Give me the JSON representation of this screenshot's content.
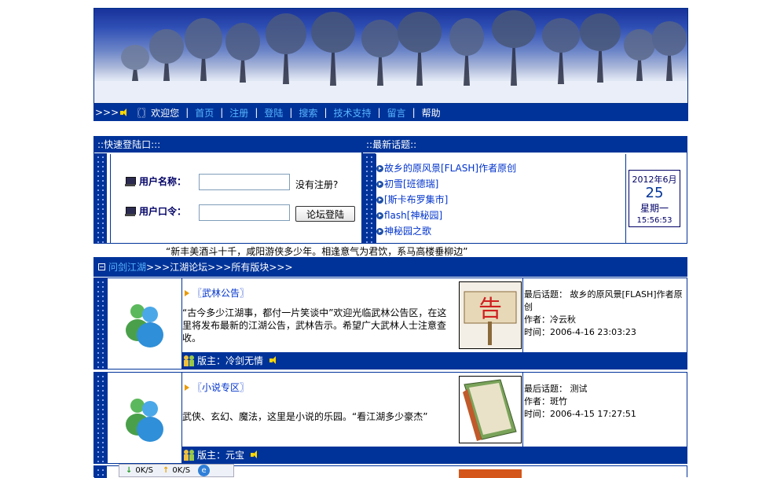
{
  "nav": {
    "arrows": ">>>",
    "welcome": "〖〗欢迎您",
    "links": [
      "首页",
      "注册",
      "登陆",
      "搜索",
      "技术支持",
      "留言"
    ],
    "help": "帮助"
  },
  "login": {
    "header": "::快速登陆口:::",
    "username_label": "用户名称：",
    "password_label": "用户口令：",
    "register_hint": "没有注册?",
    "submit_label": "论坛登陆"
  },
  "latest": {
    "header": "::最新话题::",
    "topics": [
      "故乡的原风景[FLASH]作者原创",
      "初雪[班德瑞]",
      "[斯卡布罗集市]",
      "flash[神秘园]",
      "神秘园之歌"
    ],
    "calendar": {
      "year_month": "2012年6月",
      "day": "25",
      "weekday": "星期一",
      "time": "15:56:53"
    }
  },
  "quote": "“新丰美酒斗十千，咸阳游侠多少年。相逢意气为君饮，系马高楼垂柳边”",
  "breadcrumb": {
    "link": "问剑江湖",
    "rest": ">>>江湖论坛>>>所有版块>>>"
  },
  "forums": [
    {
      "title": "〖武林公告〗",
      "description": "“古今多少江湖事，都付一片笑谈中”欢迎光临武林公告区，在这里将发布最新的江湖公告，武林告示。希望广大武林人士注意查收。",
      "last_topic_label": "最后话题：",
      "last_topic": "故乡的原风景[FLASH]作者原创",
      "author_label": "作者：",
      "author": "冷云秋",
      "time_label": "时间：",
      "time": "2006-4-16 23:03:23",
      "moderator_label": "版主：",
      "moderator": "冷剑无情",
      "thumb_glyph": "告"
    },
    {
      "title": "〖小说专区〗",
      "description": "武侠、玄幻、魔法，这里是小说的乐园。“看江湖多少豪杰”",
      "last_topic_label": "最后话题：",
      "last_topic": "测试",
      "author_label": "作者：",
      "author": "斑竹",
      "time_label": "时间：",
      "time": "2006-4-15 17:27:51",
      "moderator_label": "版主：",
      "moderator": "元宝",
      "thumb_glyph": ""
    }
  ],
  "netbar": {
    "down": "0K/S",
    "up": "0K/S"
  }
}
